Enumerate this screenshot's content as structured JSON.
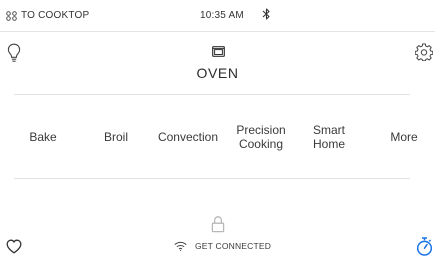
{
  "status_bar": {
    "cooktop_link": "TO COOKTOP",
    "time": "10:35 AM",
    "bluetooth_icon": "bluetooth-icon"
  },
  "header": {
    "title": "OVEN",
    "left_icon": "light-bulb-icon",
    "right_icon": "gear-icon",
    "title_icon": "oven-icon"
  },
  "modes": [
    {
      "label": "Bake"
    },
    {
      "label": "Broil"
    },
    {
      "label": "Convection"
    },
    {
      "label": "Precision\nCooking"
    },
    {
      "label": "Smart\nHome"
    },
    {
      "label": "More"
    }
  ],
  "footer": {
    "connect_label": "GET CONNECTED",
    "left_icon": "heart-icon",
    "center_icon": "lock-icon",
    "right_icon": "timer-icon",
    "accent_color": "#1a73e8"
  }
}
